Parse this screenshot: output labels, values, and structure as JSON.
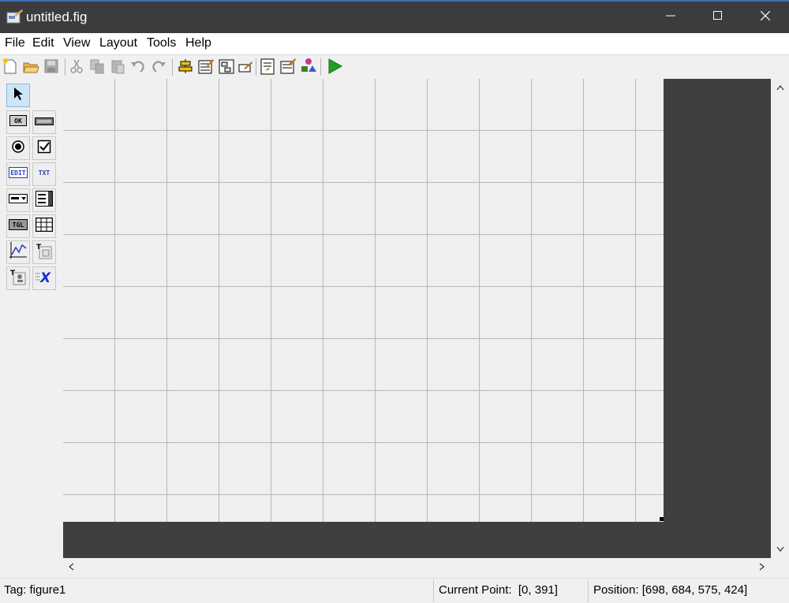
{
  "window": {
    "title": "untitled.fig",
    "controls": {
      "minimize": "minimize-icon",
      "maximize": "maximize-icon",
      "close": "close-icon"
    }
  },
  "menu": {
    "items": [
      "File",
      "Edit",
      "View",
      "Layout",
      "Tools",
      "Help"
    ]
  },
  "toolbar": {
    "icons": [
      "new-icon",
      "open-icon",
      "save-icon",
      "cut-icon",
      "copy-icon",
      "paste-icon",
      "undo-icon",
      "redo-icon",
      "align-icon",
      "menu-editor-icon",
      "tab-order-icon",
      "toolbar-editor-icon",
      "editor-icon",
      "property-inspector-icon",
      "object-browser-icon",
      "run-icon"
    ],
    "run_color": "#22a022"
  },
  "palette": {
    "selected": "select-arrow",
    "tools": [
      {
        "name": "select-arrow-icon"
      },
      {
        "name": "push-button-icon",
        "label": "OK"
      },
      {
        "name": "slider-icon"
      },
      {
        "name": "radio-button-icon"
      },
      {
        "name": "checkbox-icon"
      },
      {
        "name": "edit-text-icon",
        "label": "EDIT"
      },
      {
        "name": "static-text-icon",
        "label": "TXT"
      },
      {
        "name": "popup-menu-icon"
      },
      {
        "name": "listbox-icon"
      },
      {
        "name": "toggle-button-icon",
        "label": "TGL"
      },
      {
        "name": "table-icon"
      },
      {
        "name": "axes-icon"
      },
      {
        "name": "panel-icon"
      },
      {
        "name": "button-group-icon"
      },
      {
        "name": "activex-icon"
      }
    ]
  },
  "canvas": {
    "grid_color": "#b7b7b7",
    "background": "#3f3f3f",
    "figure_color": "#efefef"
  },
  "status": {
    "tag": "Tag: figure1",
    "current_point": "Current Point:  [0, 391]",
    "position": "Position: [698, 684, 575, 424]"
  }
}
